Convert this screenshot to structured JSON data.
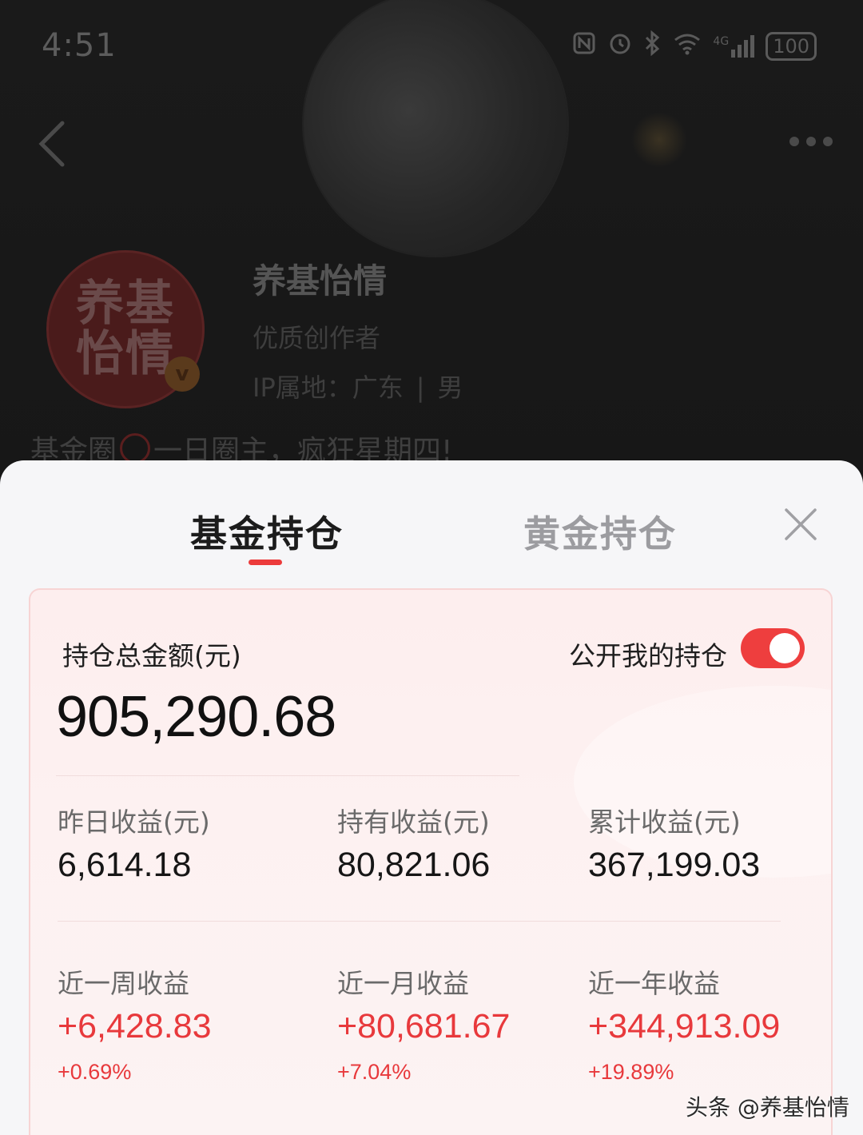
{
  "status_bar": {
    "time": "4:51",
    "network": "4G",
    "battery": "100"
  },
  "profile": {
    "avatar_text_line1": "养基",
    "avatar_text_line2": "怡情",
    "verified_badge": "v",
    "name": "养基怡情",
    "tag": "优质创作者",
    "location": "IP属地：广东",
    "gender": "男",
    "bio_prefix": "基金圈",
    "bio_suffix": "一日圈主，疯狂星期四!"
  },
  "tabs": [
    {
      "label": "基金持仓",
      "active": true
    },
    {
      "label": "黄金持仓",
      "active": false
    }
  ],
  "holdings": {
    "total_label": "持仓总金额(元)",
    "total_value": "905,290.68",
    "public_label": "公开我的持仓",
    "public_enabled": true,
    "stats": [
      {
        "label": "昨日收益(元)",
        "value": "6,614.18"
      },
      {
        "label": "持有收益(元)",
        "value": "80,821.06"
      },
      {
        "label": "累计收益(元)",
        "value": "367,199.03"
      }
    ],
    "periods": [
      {
        "label": "近一周收益",
        "value": "+6,428.83",
        "pct": "+0.69%"
      },
      {
        "label": "近一月收益",
        "value": "+80,681.67",
        "pct": "+7.04%"
      },
      {
        "label": "近一年收益",
        "value": "+344,913.09",
        "pct": "+19.89%"
      }
    ]
  },
  "watermark": "头条 @养基怡情",
  "colors": {
    "accent": "#ec3b3b",
    "gain": "#e8393c"
  },
  "icons": [
    "back-arrow-icon",
    "more-icon",
    "close-icon",
    "nfc-icon",
    "alarm-icon",
    "bluetooth-icon",
    "wifi-icon",
    "signal-icon",
    "battery-icon"
  ]
}
